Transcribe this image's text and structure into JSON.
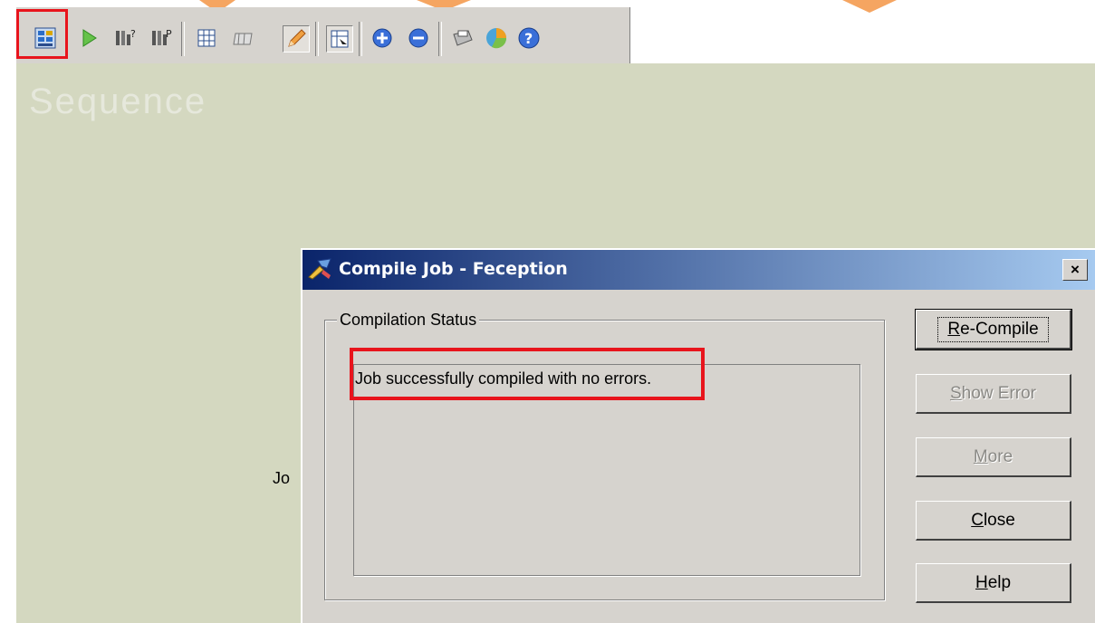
{
  "canvas": {
    "title": "Sequence",
    "partial_text": "Jo"
  },
  "toolbar": {
    "icons": [
      "compile-icon",
      "run-icon",
      "job-properties-icon",
      "job-parameters-icon",
      "grid-icon",
      "table-icon",
      "pencil-icon",
      "link-icon",
      "zoom-in-icon",
      "zoom-out-icon",
      "print-icon",
      "pie-chart-icon",
      "help-icon"
    ]
  },
  "dialog": {
    "title": "Compile Job - Feception",
    "close_glyph": "×",
    "group_label": "Compilation Status",
    "status_message": "Job successfully compiled with no errors.",
    "buttons": {
      "recompile": {
        "mnemonic": "R",
        "rest": "e-Compile"
      },
      "show_error": {
        "mnemonic": "S",
        "rest": "how Error"
      },
      "more": {
        "mnemonic": "M",
        "rest": "ore"
      },
      "close": {
        "mnemonic": "C",
        "rest": "lose"
      },
      "help": {
        "mnemonic": "H",
        "rest": "elp"
      }
    }
  },
  "colors": {
    "highlight": "#e8141c",
    "canvas": "#d4d8c0",
    "dialog": "#d6d3ce",
    "titlebar_start": "#0a246a",
    "titlebar_end": "#a6caf0"
  }
}
